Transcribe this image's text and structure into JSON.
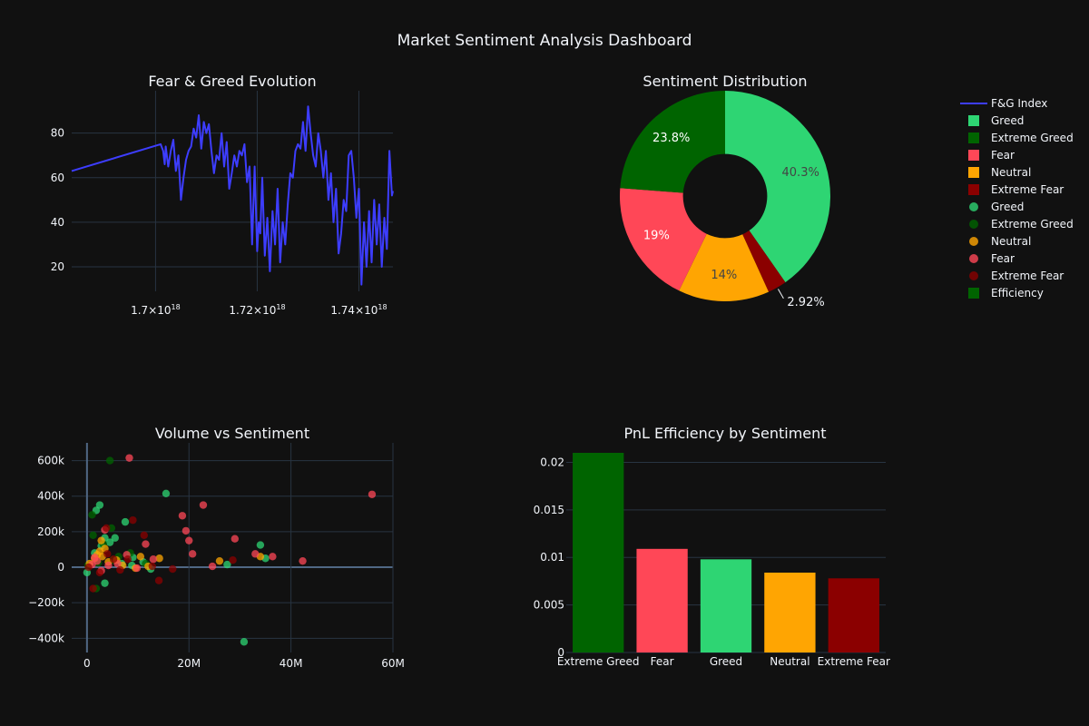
{
  "page": {
    "title": "Market Sentiment Analysis Dashboard",
    "background": "#111111",
    "grid_color": "#283442",
    "text_color": "#f2f5fa"
  },
  "legend": {
    "placement": "right",
    "items": [
      {
        "label": "F&G Index",
        "symbol": "line",
        "color": "#3d3dff"
      },
      {
        "label": "Greed",
        "symbol": "square",
        "color": "#2ed573"
      },
      {
        "label": "Extreme Greed",
        "symbol": "square",
        "color": "#006400"
      },
      {
        "label": "Fear",
        "symbol": "square",
        "color": "#ff4757"
      },
      {
        "label": "Neutral",
        "symbol": "square",
        "color": "#ffa502"
      },
      {
        "label": "Extreme Fear",
        "symbol": "square",
        "color": "#8b0000"
      },
      {
        "label": "Greed",
        "symbol": "circle",
        "color": "#2ed573"
      },
      {
        "label": "Extreme Greed",
        "symbol": "circle",
        "color": "#006400"
      },
      {
        "label": "Neutral",
        "symbol": "circle",
        "color": "#ffa502"
      },
      {
        "label": "Fear",
        "symbol": "circle",
        "color": "#ff4757"
      },
      {
        "label": "Extreme Fear",
        "symbol": "circle",
        "color": "#8b0000"
      },
      {
        "label": "Efficiency",
        "symbol": "square",
        "color": "#006400"
      }
    ]
  },
  "chart_data": [
    {
      "id": "fg",
      "type": "line",
      "title": "Fear & Greed Evolution",
      "series": [
        {
          "name": "F&G Index",
          "color": "#3d3dff"
        }
      ],
      "xlim": [
        1.6835e+18,
        1.7467e+18
      ],
      "ylim": [
        9,
        99
      ],
      "x_ticks": [
        {
          "value": 1.7e+18,
          "mantissa": "1.7",
          "exp": "18"
        },
        {
          "value": 1.72e+18,
          "mantissa": "1.72",
          "exp": "18"
        },
        {
          "value": 1.74e+18,
          "mantissa": "1.74",
          "exp": "18"
        }
      ],
      "y_ticks": [
        {
          "value": 20,
          "label": "20"
        },
        {
          "value": 40,
          "label": "40"
        },
        {
          "value": 60,
          "label": "60"
        },
        {
          "value": 80,
          "label": "80"
        }
      ],
      "x": [
        1.6835e+18,
        1.701e+18,
        1.7015e+18,
        1.7018e+18,
        1.702e+18,
        1.7025e+18,
        1.703e+18,
        1.7035e+18,
        1.704e+18,
        1.7045e+18,
        1.705e+18,
        1.7055e+18,
        1.706e+18,
        1.7065e+18,
        1.707e+18,
        1.7075e+18,
        1.708e+18,
        1.7085e+18,
        1.709e+18,
        1.7095e+18,
        1.71e+18,
        1.7105e+18,
        1.711e+18,
        1.7115e+18,
        1.712e+18,
        1.7125e+18,
        1.713e+18,
        1.7135e+18,
        1.714e+18,
        1.7145e+18,
        1.715e+18,
        1.7155e+18,
        1.716e+18,
        1.7165e+18,
        1.717e+18,
        1.7175e+18,
        1.718e+18,
        1.7185e+18,
        1.719e+18,
        1.7195e+18,
        1.72e+18,
        1.7203e+18,
        1.7206e+18,
        1.721e+18,
        1.7215e+18,
        1.722e+18,
        1.7225e+18,
        1.723e+18,
        1.7235e+18,
        1.724e+18,
        1.7245e+18,
        1.725e+18,
        1.7255e+18,
        1.726e+18,
        1.7265e+18,
        1.727e+18,
        1.7275e+18,
        1.728e+18,
        1.7285e+18,
        1.729e+18,
        1.7295e+18,
        1.73e+18,
        1.7305e+18,
        1.731e+18,
        1.7315e+18,
        1.732e+18,
        1.7325e+18,
        1.733e+18,
        1.7335e+18,
        1.734e+18,
        1.7345e+18,
        1.735e+18,
        1.7355e+18,
        1.736e+18,
        1.7365e+18,
        1.737e+18,
        1.7375e+18,
        1.738e+18,
        1.7385e+18,
        1.739e+18,
        1.7395e+18,
        1.74e+18,
        1.7405e+18,
        1.741e+18,
        1.7415e+18,
        1.742e+18,
        1.7425e+18,
        1.743e+18,
        1.7435e+18,
        1.744e+18,
        1.7445e+18,
        1.745e+18,
        1.7455e+18,
        1.746e+18,
        1.7465e+18,
        1.7467e+18
      ],
      "y": [
        63,
        75,
        72,
        66,
        74,
        65,
        72,
        77,
        63,
        70,
        50,
        60,
        68,
        72,
        74,
        82,
        78,
        88,
        73,
        85,
        80,
        84,
        72,
        62,
        70,
        68,
        80,
        65,
        76,
        55,
        62,
        70,
        65,
        72,
        70,
        75,
        58,
        65,
        30,
        65,
        27,
        40,
        35,
        60,
        25,
        42,
        18,
        45,
        30,
        55,
        22,
        40,
        30,
        48,
        62,
        60,
        72,
        75,
        73,
        85,
        72,
        92,
        80,
        70,
        65,
        80,
        72,
        60,
        72,
        50,
        62,
        40,
        55,
        26,
        35,
        50,
        45,
        70,
        72,
        60,
        42,
        55,
        12,
        40,
        20,
        45,
        22,
        50,
        30,
        48,
        20,
        42,
        28,
        72,
        52,
        54
      ]
    },
    {
      "id": "pie",
      "type": "pie",
      "title": "Sentiment Distribution",
      "hole": 0.4,
      "categories": [
        "Greed",
        "Extreme Greed",
        "Fear",
        "Neutral",
        "Extreme Fear"
      ],
      "values": [
        40.3,
        23.8,
        19,
        14,
        2.92
      ],
      "labels": [
        "40.3%",
        "23.8%",
        "19%",
        "14%",
        "2.92%"
      ],
      "colors": [
        "#2ed573",
        "#006400",
        "#ff4757",
        "#ffa502",
        "#8b0000"
      ],
      "order": [
        "Greed",
        "Extreme Fear",
        "Neutral",
        "Fear",
        "Extreme Greed"
      ]
    },
    {
      "id": "scatter",
      "type": "scatter",
      "title": "Volume vs Sentiment",
      "xlim": [
        -3000000,
        60000000
      ],
      "ylim": [
        -480000,
        700000
      ],
      "x_ticks": [
        {
          "value": 0,
          "label": "0"
        },
        {
          "value": 20000000,
          "label": "20M"
        },
        {
          "value": 40000000,
          "label": "40M"
        },
        {
          "value": 60000000,
          "label": "60M"
        }
      ],
      "y_ticks": [
        {
          "value": -400000,
          "label": "−400k"
        },
        {
          "value": -200000,
          "label": "−200k"
        },
        {
          "value": 0,
          "label": "0"
        },
        {
          "value": 200000,
          "label": "200k"
        },
        {
          "value": 400000,
          "label": "400k"
        },
        {
          "value": 600000,
          "label": "600k"
        }
      ],
      "series": [
        {
          "name": "Greed",
          "color": "#2ed573",
          "points": [
            [
              2500000,
              350000
            ],
            [
              15500000,
              415000
            ],
            [
              1800000,
              320000
            ],
            [
              34000000,
              125000
            ],
            [
              5500000,
              165000
            ],
            [
              7500000,
              255000
            ],
            [
              3500000,
              165000
            ],
            [
              2800000,
              120000
            ],
            [
              1500000,
              80000
            ],
            [
              4500000,
              140000
            ],
            [
              6800000,
              20000
            ],
            [
              12500000,
              -10000
            ],
            [
              11000000,
              30000
            ],
            [
              9000000,
              55000
            ],
            [
              3500000,
              -90000
            ],
            [
              30800000,
              -420000
            ],
            [
              27500000,
              15000
            ],
            [
              35000000,
              50000
            ],
            [
              0,
              -30000
            ],
            [
              8800000,
              10000
            ]
          ]
        },
        {
          "name": "Extreme Greed",
          "color": "#006400",
          "points": [
            [
              4500000,
              600000
            ],
            [
              1000000,
              295000
            ],
            [
              4800000,
              220000
            ],
            [
              1200000,
              180000
            ],
            [
              3200000,
              130000
            ],
            [
              1800000,
              -120000
            ],
            [
              6200000,
              60000
            ],
            [
              5000000,
              40000
            ],
            [
              2200000,
              25000
            ],
            [
              200000,
              10000
            ],
            [
              8500000,
              80000
            ],
            [
              11500000,
              20000
            ]
          ]
        },
        {
          "name": "Neutral",
          "color": "#ffa502",
          "points": [
            [
              2800000,
              150000
            ],
            [
              3500000,
              105000
            ],
            [
              2000000,
              70000
            ],
            [
              1500000,
              50000
            ],
            [
              2500000,
              90000
            ],
            [
              3000000,
              60000
            ],
            [
              4200000,
              30000
            ],
            [
              5800000,
              40000
            ],
            [
              7000000,
              10000
            ],
            [
              10500000,
              60000
            ],
            [
              14200000,
              50000
            ],
            [
              26000000,
              35000
            ],
            [
              34000000,
              60000
            ],
            [
              500000,
              20000
            ],
            [
              9500000,
              -5000
            ],
            [
              12000000,
              5000
            ]
          ]
        },
        {
          "name": "Fear",
          "color": "#ff4757",
          "points": [
            [
              8300000,
              615000
            ],
            [
              22800000,
              350000
            ],
            [
              55900000,
              410000
            ],
            [
              18700000,
              290000
            ],
            [
              19400000,
              205000
            ],
            [
              20000000,
              150000
            ],
            [
              29000000,
              160000
            ],
            [
              20700000,
              75000
            ],
            [
              33000000,
              75000
            ],
            [
              36400000,
              60000
            ],
            [
              42300000,
              35000
            ],
            [
              3500000,
              210000
            ],
            [
              7800000,
              70000
            ],
            [
              13000000,
              45000
            ],
            [
              11500000,
              130000
            ],
            [
              24600000,
              5000
            ],
            [
              1000000,
              15000
            ],
            [
              2000000,
              35000
            ],
            [
              4200000,
              10000
            ],
            [
              6000000,
              20000
            ],
            [
              9800000,
              -5000
            ],
            [
              2800000,
              -20000
            ],
            [
              1500000,
              55000
            ]
          ]
        },
        {
          "name": "Extreme Fear",
          "color": "#8b0000",
          "points": [
            [
              9000000,
              265000
            ],
            [
              11200000,
              180000
            ],
            [
              14100000,
              -75000
            ],
            [
              16800000,
              -10000
            ],
            [
              28600000,
              40000
            ],
            [
              3800000,
              220000
            ],
            [
              1200000,
              -120000
            ],
            [
              300000,
              0
            ],
            [
              5200000,
              45000
            ],
            [
              6500000,
              -15000
            ],
            [
              2500000,
              -30000
            ],
            [
              4000000,
              75000
            ],
            [
              8000000,
              45000
            ],
            [
              12800000,
              5000
            ]
          ]
        }
      ]
    },
    {
      "id": "bar",
      "type": "bar",
      "title": "PnL Efficiency by Sentiment",
      "series": [
        {
          "name": "Efficiency"
        }
      ],
      "categories": [
        "Extreme Greed",
        "Fear",
        "Greed",
        "Neutral",
        "Extreme Fear"
      ],
      "values": [
        0.021,
        0.0109,
        0.0098,
        0.0084,
        0.0078
      ],
      "colors": [
        "#006400",
        "#ff4757",
        "#2ed573",
        "#ffa502",
        "#8b0000"
      ],
      "ylim": [
        0,
        0.021
      ],
      "y_ticks": [
        {
          "value": 0,
          "label": "0"
        },
        {
          "value": 0.005,
          "label": "0.005"
        },
        {
          "value": 0.01,
          "label": "0.01"
        },
        {
          "value": 0.015,
          "label": "0.015"
        },
        {
          "value": 0.02,
          "label": "0.02"
        }
      ]
    }
  ]
}
